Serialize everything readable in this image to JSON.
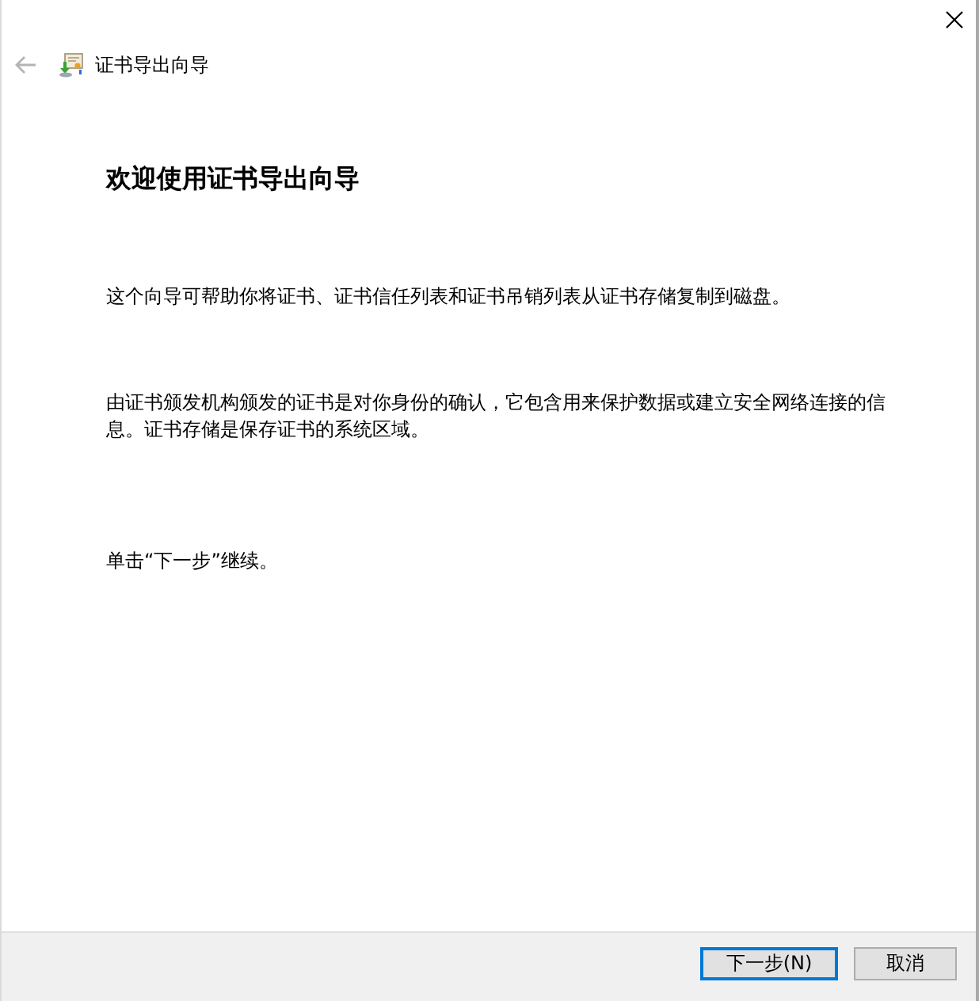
{
  "header": {
    "back_button": {
      "disabled": true
    },
    "title": "证书导出向导"
  },
  "content": {
    "heading": "欢迎使用证书导出向导",
    "paragraphs": [
      "这个向导可帮助你将证书、证书信任列表和证书吊销列表从证书存储复制到磁盘。",
      "由证书颁发机构颁发的证书是对你身份的确认，它包含用来保护数据或建立安全网络连接的信息。证书存储是保存证书的系统区域。",
      "单击“下一步”继续。"
    ]
  },
  "buttons": [
    {
      "label": "下一步(N)",
      "default": true
    },
    {
      "label": "取消",
      "default": false
    }
  ]
}
